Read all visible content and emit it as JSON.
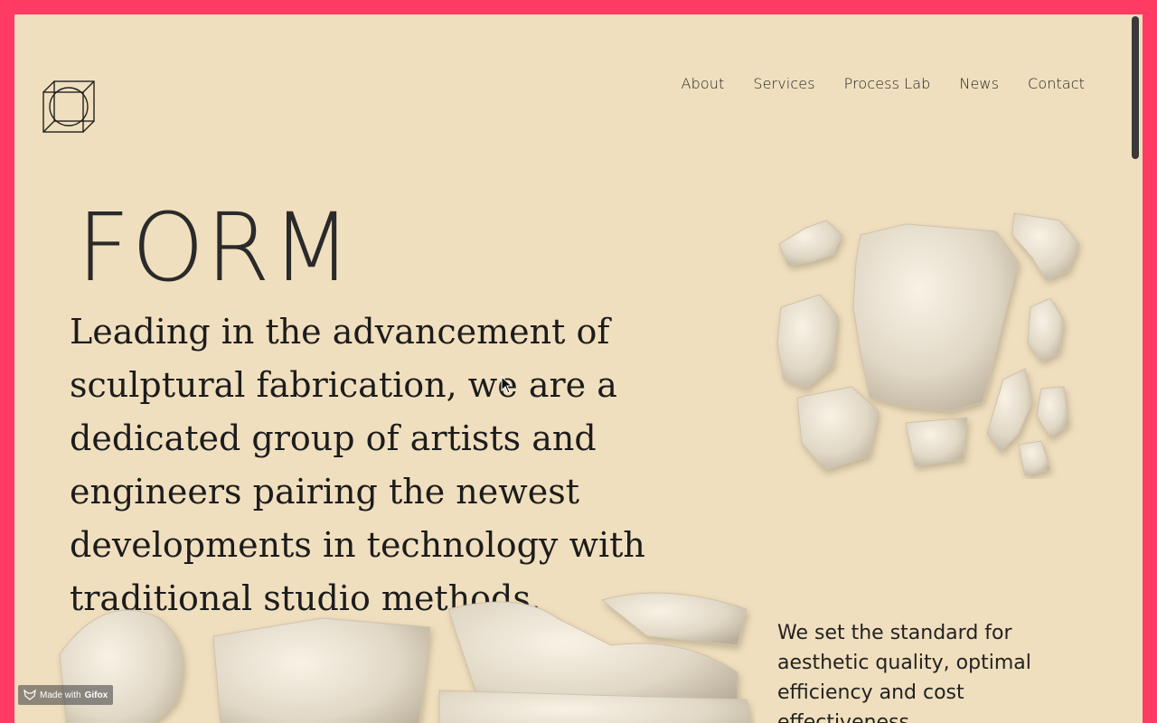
{
  "brand": {
    "logo_icon": "cube-circle-logo-icon",
    "title": "FORM"
  },
  "nav": {
    "items": [
      {
        "label": "About"
      },
      {
        "label": "Services"
      },
      {
        "label": "Process Lab"
      },
      {
        "label": "News"
      },
      {
        "label": "Contact"
      }
    ]
  },
  "hero": {
    "lead": "Leading in the advancement of sculptural fabrication, we are a dedicated group of artists and engineers pairing the newest developments in technology with traditional studio methods."
  },
  "section": {
    "text": "We set the standard for aesthetic quality, optimal efficiency and cost effectiveness."
  },
  "overlay": {
    "gifox_prefix": "Made with",
    "gifox_brand": "Gifox"
  },
  "colors": {
    "frame": "#ff3b63",
    "background": "#f0dfbe",
    "text": "#1c1c1c"
  }
}
